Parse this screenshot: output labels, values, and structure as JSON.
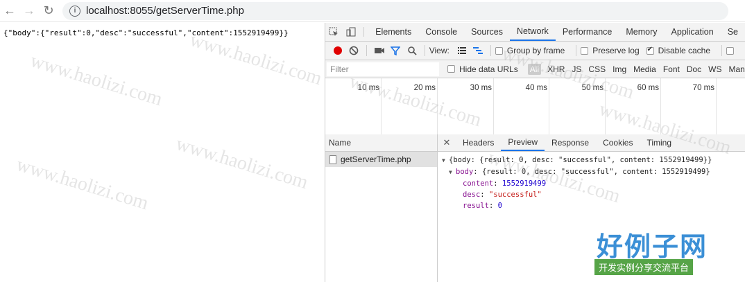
{
  "address_bar": {
    "host": "localhost",
    "port_path": ":8055/getServerTime.php"
  },
  "page": {
    "json_text": "{\"body\":{\"result\":0,\"desc\":\"successful\",\"content\":1552919499}}"
  },
  "devtools": {
    "tabs": [
      "Elements",
      "Console",
      "Sources",
      "Network",
      "Performance",
      "Memory",
      "Application",
      "Se"
    ],
    "active_tab": "Network",
    "toolbar": {
      "view_label": "View:",
      "group_by_frame": "Group by frame",
      "preserve_log": "Preserve log",
      "disable_cache": "Disable cache"
    },
    "filter": {
      "placeholder": "Filter",
      "hide_data_urls": "Hide data URLs",
      "types": [
        "All",
        "XHR",
        "JS",
        "CSS",
        "Img",
        "Media",
        "Font",
        "Doc",
        "WS",
        "Manifes"
      ]
    },
    "timeline_ticks": [
      "10 ms",
      "20 ms",
      "30 ms",
      "40 ms",
      "50 ms",
      "60 ms",
      "70 ms"
    ],
    "name_header": "Name",
    "requests": [
      "getServerTime.php"
    ],
    "detail_tabs": [
      "Headers",
      "Preview",
      "Response",
      "Cookies",
      "Timing"
    ],
    "active_detail_tab": "Preview",
    "preview": {
      "line1": "{body: {result: 0, desc: \"successful\", content: 1552919499}}",
      "line2_key": "body",
      "line2_rest": "{result: 0, desc: \"successful\", content: 1552919499}",
      "content_key": "content",
      "content_val": "1552919499",
      "desc_key": "desc",
      "desc_val": "\"successful\"",
      "result_key": "result",
      "result_val": "0"
    }
  },
  "watermark": {
    "text": "www.haolizi.com",
    "logo_cn": "好例子网",
    "logo_sub": "开发实例分享交流平台"
  },
  "colors": {
    "accent": "#1a73e8",
    "record": "#e00000",
    "filter_icon": "#1a73e8"
  }
}
